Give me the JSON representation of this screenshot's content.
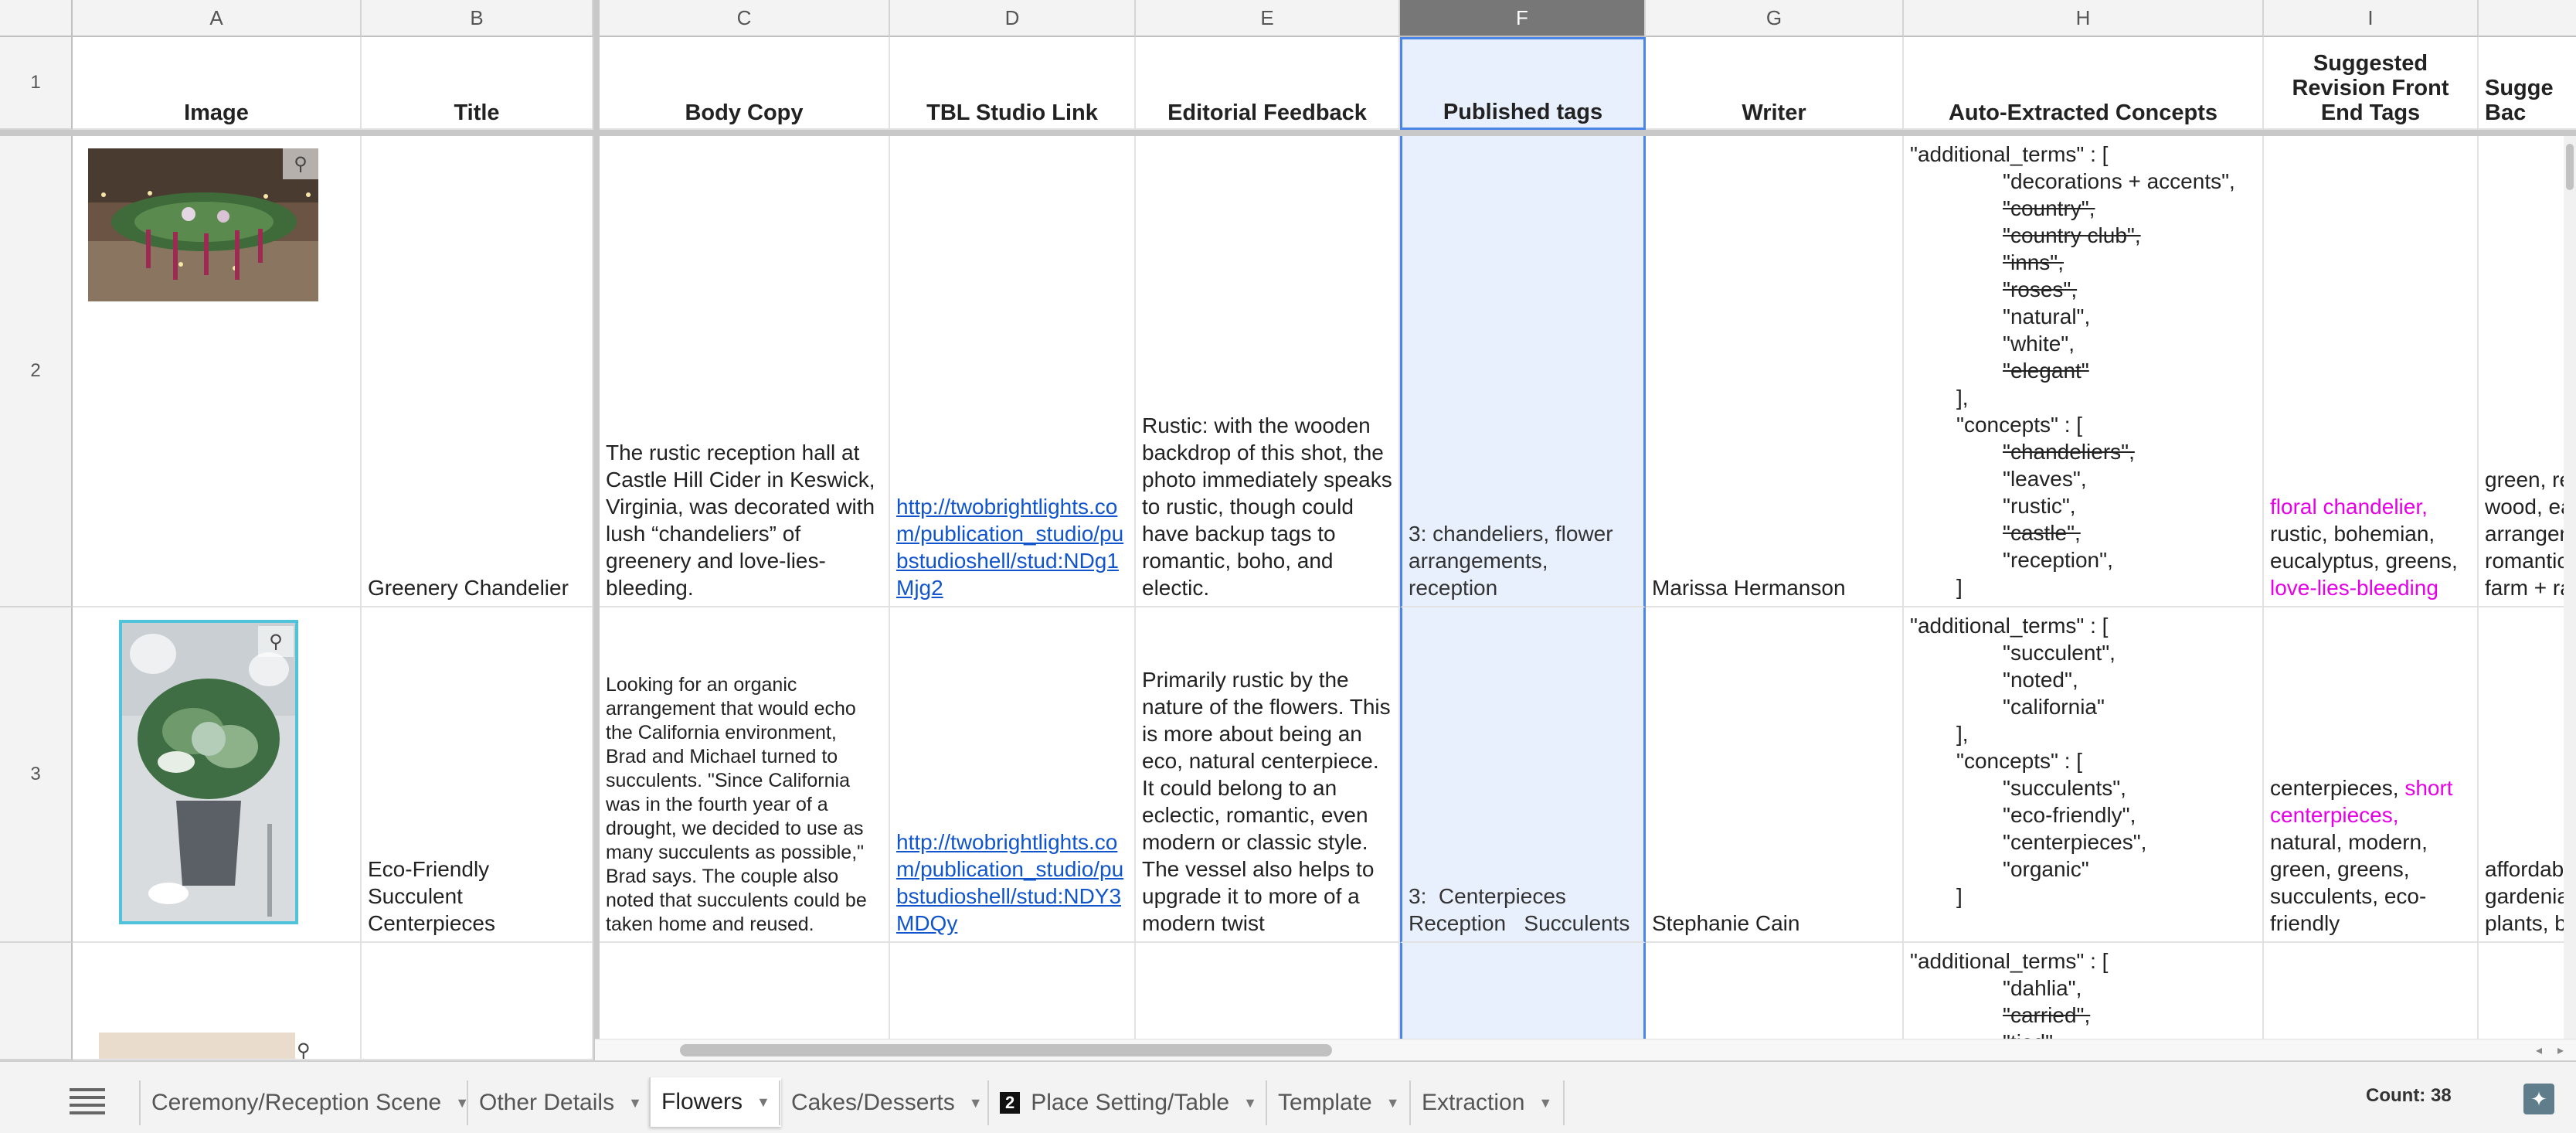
{
  "columns": [
    "A",
    "B",
    "C",
    "D",
    "E",
    "F",
    "G",
    "H",
    "I"
  ],
  "rows": [
    "1",
    "2",
    "3"
  ],
  "headers": {
    "image": "Image",
    "title": "Title",
    "body": "Body Copy",
    "link": "TBL Studio Link",
    "feedback": "Editorial Feedback",
    "published": "Published tags",
    "writer": "Writer",
    "concepts": "Auto-Extracted Concepts",
    "suggested_front": "Suggested Revision Front End Tags",
    "suggested_back": "Sugge Bac"
  },
  "row2": {
    "title": "Greenery Chandelier",
    "body": "The rustic reception hall at Castle Hill Cider in Keswick, Virginia, was decorated with lush “chandeliers” of greenery and love-lies-bleeding.",
    "link": "http://twobrightlights.com/publication_studio/pubstudioshell/stud:NDg1Mjg2",
    "feedback": "Rustic: with the wooden backdrop of this shot, the photo immediately speaks to rustic, though could have backup tags to romantic, boho, and electic.",
    "published": "3: chandeliers, flower arrangements, reception",
    "writer": "Marissa Hermanson",
    "concepts": [
      {
        "text": "\"additional_terms\" : [",
        "indent": 0,
        "strike": false
      },
      {
        "text": "\"decorations + accents\",",
        "indent": 2,
        "strike": false
      },
      {
        "text": "\"country\",",
        "indent": 2,
        "strike": true
      },
      {
        "text": "\"country club\",",
        "indent": 2,
        "strike": true
      },
      {
        "text": "\"inns\",",
        "indent": 2,
        "strike": true
      },
      {
        "text": "\"roses\",",
        "indent": 2,
        "strike": true
      },
      {
        "text": "\"natural\",",
        "indent": 2,
        "strike": false
      },
      {
        "text": "\"white\",",
        "indent": 2,
        "strike": false
      },
      {
        "text": "\"elegant\"",
        "indent": 2,
        "strike": true
      },
      {
        "text": "],",
        "indent": 1,
        "strike": false
      },
      {
        "text": "\"concepts\" : [",
        "indent": 1,
        "strike": false
      },
      {
        "text": "\"chandeliers\",",
        "indent": 2,
        "strike": true
      },
      {
        "text": "\"leaves\",",
        "indent": 2,
        "strike": false
      },
      {
        "text": "\"rustic\",",
        "indent": 2,
        "strike": false
      },
      {
        "text": "\"castle\",",
        "indent": 2,
        "strike": true
      },
      {
        "text": "\"reception\",",
        "indent": 2,
        "strike": false
      },
      {
        "text": "]",
        "indent": 1,
        "strike": false
      }
    ],
    "suggested_front": [
      {
        "text": "floral chandelier,",
        "magenta": true
      },
      {
        "text": " rustic, bohemian, eucalyptus, greens, ",
        "magenta": false
      },
      {
        "text": "love-lies-bleeding",
        "magenta": true
      }
    ],
    "suggested_back": [
      "green, re",
      "wood, ea",
      "arrangen",
      "romantic",
      "farm + ra"
    ]
  },
  "row3": {
    "title": "Eco-Friendly Succulent Centerpieces",
    "body": "Looking for an organic arrangement that would echo the California environment, Brad and Michael turned to succulents. \"Since California was in the fourth year of a drought, we decided to use as many succulents as possible,\" Brad says. The couple also noted that succulents could be taken home and reused.",
    "link": "http://twobrightlights.com/publication_studio/pubstudioshell/stud:NDY3MDQy",
    "feedback": "Primarily rustic by the nature of the flowers. This is more about being an eco, natural centerpiece. It could belong to an eclectic, romantic, even modern or classic style. The vessel also helps to upgrade it to more of a modern twist",
    "published": "3:  Centerpieces Reception   Succulents",
    "writer": "Stephanie Cain",
    "concepts": [
      {
        "text": "\"additional_terms\" : [",
        "indent": 0,
        "strike": false
      },
      {
        "text": "\"succulent\",",
        "indent": 2,
        "strike": false
      },
      {
        "text": "\"noted\",",
        "indent": 2,
        "strike": false
      },
      {
        "text": "\"california\"",
        "indent": 2,
        "strike": false
      },
      {
        "text": "],",
        "indent": 1,
        "strike": false
      },
      {
        "text": "\"concepts\" : [",
        "indent": 1,
        "strike": false
      },
      {
        "text": "\"succulents\",",
        "indent": 2,
        "strike": false
      },
      {
        "text": "\"eco-friendly\",",
        "indent": 2,
        "strike": false
      },
      {
        "text": "\"centerpieces\",",
        "indent": 2,
        "strike": false
      },
      {
        "text": "\"organic\"",
        "indent": 2,
        "strike": false
      },
      {
        "text": "]",
        "indent": 1,
        "strike": false
      }
    ],
    "suggested_front": [
      {
        "text": "centerpieces, ",
        "magenta": false
      },
      {
        "text": "short centerpieces,",
        "magenta": true
      },
      {
        "text": " natural, modern, green, greens, succulents, eco-friendly",
        "magenta": false
      }
    ],
    "suggested_back": [
      "affordabl",
      "gardenia",
      "plants, be"
    ]
  },
  "row4": {
    "concepts": [
      {
        "text": "\"additional_terms\" : [",
        "indent": 0,
        "strike": false
      },
      {
        "text": "\"dahlia\",",
        "indent": 2,
        "strike": false
      },
      {
        "text": "\"carried\",",
        "indent": 2,
        "strike": true
      },
      {
        "text": "\"tied\",",
        "indent": 2,
        "strike": true
      }
    ]
  },
  "tabs": [
    {
      "label": "Ceremony/Reception Scene",
      "active": false,
      "badge": ""
    },
    {
      "label": "Other Details",
      "active": false,
      "badge": ""
    },
    {
      "label": "Flowers",
      "active": true,
      "badge": ""
    },
    {
      "label": "Cakes/Desserts",
      "active": false,
      "badge": ""
    },
    {
      "label": "Place Setting/Table",
      "active": false,
      "badge": "2"
    },
    {
      "label": "Template",
      "active": false,
      "badge": ""
    },
    {
      "label": "Extraction",
      "active": false,
      "badge": ""
    }
  ],
  "status": {
    "count": "Count: 38"
  },
  "icons": {
    "sheet_list": "menu-lines-icon",
    "explore": "explore-star-icon",
    "image_pin": "pin-icon"
  },
  "colors": {
    "link": "#1155cc",
    "magenta": "#e600e6",
    "selected_column": "#e8effd",
    "selection_border": "#4a86e8"
  }
}
